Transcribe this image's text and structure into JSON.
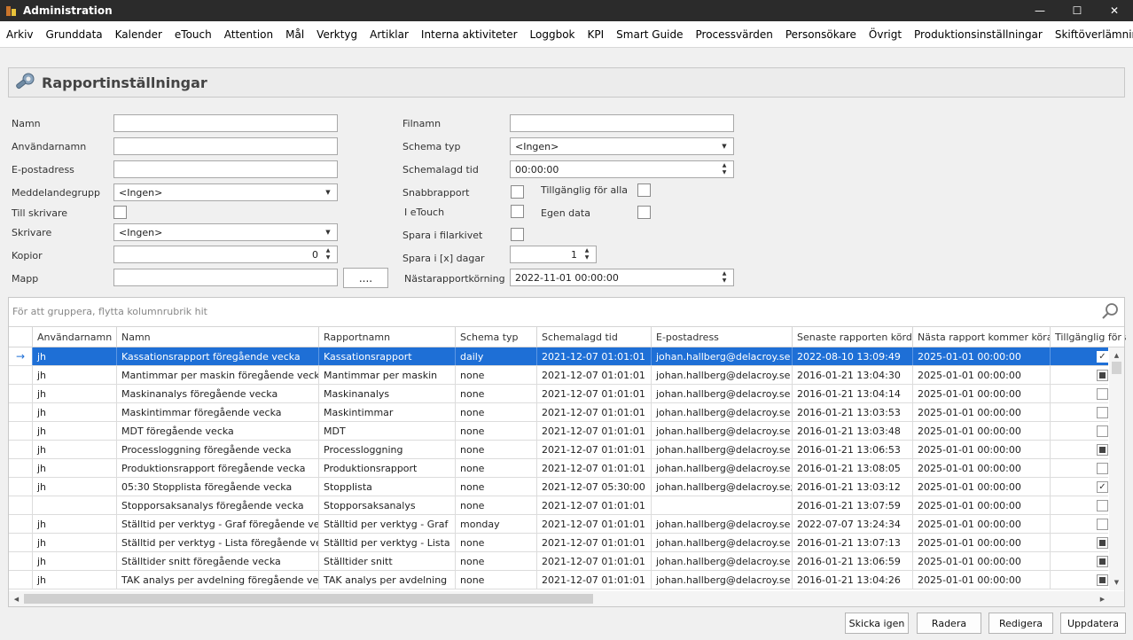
{
  "window": {
    "title": "Administration",
    "icon": "app-logo-icon",
    "controls": [
      "minimize-icon",
      "maximize-icon",
      "close-icon"
    ]
  },
  "menu": [
    "Arkiv",
    "Grunddata",
    "Kalender",
    "eTouch",
    "Attention",
    "Mål",
    "Verktyg",
    "Artiklar",
    "Interna aktiviteter",
    "Loggbok",
    "KPI",
    "Smart Guide",
    "Processvärden",
    "Personsökare",
    "Övrigt",
    "Produktionsinställningar",
    "Skiftöverlämning"
  ],
  "panel": {
    "title": "Rapportinställningar",
    "icon": "wrench-icon"
  },
  "form": {
    "left": {
      "namn": {
        "label": "Namn",
        "value": ""
      },
      "anvandarnamn": {
        "label": "Användarnamn",
        "value": ""
      },
      "epost": {
        "label": "E-postadress",
        "value": ""
      },
      "meddelandegrupp": {
        "label": "Meddelandegrupp",
        "value": "<Ingen>"
      },
      "till_skrivare": {
        "label": "Till skrivare",
        "checked": false
      },
      "skrivare": {
        "label": "Skrivare",
        "value": "<Ingen>"
      },
      "kopior": {
        "label": "Kopior",
        "value": "0"
      },
      "mapp": {
        "label": "Mapp",
        "value": "",
        "browse": "...."
      }
    },
    "right": {
      "filnamn": {
        "label": "Filnamn",
        "value": ""
      },
      "schema_typ": {
        "label": "Schema typ",
        "value": "<Ingen>"
      },
      "schemalagd_tid": {
        "label": "Schemalagd tid",
        "value": "00:00:00"
      },
      "snabbrapport": {
        "label": "Snabbrapport",
        "checked": false
      },
      "tillganglig": {
        "label": "Tillgänglig för alla",
        "checked": false
      },
      "i_etouch": {
        "label": "I eTouch",
        "checked": false
      },
      "egen_data": {
        "label": "Egen data",
        "checked": false
      },
      "spara_filarkivet": {
        "label": "Spara i filarkivet",
        "checked": false
      },
      "spara_dagar": {
        "label": "Spara i [x] dagar",
        "value": "1"
      },
      "nasta_korning": {
        "label": "Nästarapportkörning",
        "value": "2022-11-01 00:00:00"
      }
    }
  },
  "grid": {
    "group_hint": "För att gruppera, flytta kolumnrubrik hit",
    "columns": [
      "Användarnamn",
      "Namn",
      "Rapportnamn",
      "Schema typ",
      "Schemalagd tid",
      "E-postadress",
      "Senaste rapporten körd...",
      "Nästa rapport kommer köras",
      "Tillgänglig för alla"
    ],
    "rows": [
      {
        "user": "jh",
        "name": "Kassationsrapport föregående vecka",
        "report": "Kassationsrapport",
        "schema": "daily",
        "time": "2021-12-07 01:01:01",
        "email": "johan.hallberg@delacroy.se",
        "last": "2022-08-10 13:09:49",
        "next": "2025-01-01 00:00:00",
        "avail": "checked",
        "selected": true
      },
      {
        "user": "jh",
        "name": "Mantimmar per maskin föregående vecka",
        "report": "Mantimmar per maskin",
        "schema": "none",
        "time": "2021-12-07 01:01:01",
        "email": "johan.hallberg@delacroy.se",
        "last": "2016-01-21 13:04:30",
        "next": "2025-01-01 00:00:00",
        "avail": "indeterminate"
      },
      {
        "user": "jh",
        "name": "Maskinanalys föregående vecka",
        "report": "Maskinanalys",
        "schema": "none",
        "time": "2021-12-07 01:01:01",
        "email": "johan.hallberg@delacroy.se",
        "last": "2016-01-21 13:04:14",
        "next": "2025-01-01 00:00:00",
        "avail": "unchecked"
      },
      {
        "user": "jh",
        "name": "Maskintimmar föregående vecka",
        "report": "Maskintimmar",
        "schema": "none",
        "time": "2021-12-07 01:01:01",
        "email": "johan.hallberg@delacroy.se",
        "last": "2016-01-21 13:03:53",
        "next": "2025-01-01 00:00:00",
        "avail": "unchecked"
      },
      {
        "user": "jh",
        "name": "MDT föregående vecka",
        "report": "MDT",
        "schema": "none",
        "time": "2021-12-07 01:01:01",
        "email": "johan.hallberg@delacroy.se",
        "last": "2016-01-21 13:03:48",
        "next": "2025-01-01 00:00:00",
        "avail": "unchecked"
      },
      {
        "user": "jh",
        "name": "Processloggning föregående vecka",
        "report": "Processloggning",
        "schema": "none",
        "time": "2021-12-07 01:01:01",
        "email": "johan.hallberg@delacroy.se",
        "last": "2016-01-21 13:06:53",
        "next": "2025-01-01 00:00:00",
        "avail": "indeterminate"
      },
      {
        "user": "jh",
        "name": "Produktionsrapport föregående vecka",
        "report": "Produktionsrapport",
        "schema": "none",
        "time": "2021-12-07 01:01:01",
        "email": "johan.hallberg@delacroy.se",
        "last": "2016-01-21 13:08:05",
        "next": "2025-01-01 00:00:00",
        "avail": "unchecked"
      },
      {
        "user": "jh",
        "name": "05:30 Stopplista föregående vecka",
        "report": "Stopplista",
        "schema": "none",
        "time": "2021-12-07 05:30:00",
        "email": "johan.hallberg@delacroy.se;",
        "last": "2016-01-21 13:03:12",
        "next": "2025-01-01 00:00:00",
        "avail": "checked"
      },
      {
        "user": "",
        "name": "Stopporsaksanalys föregående vecka",
        "report": "Stopporsaksanalys",
        "schema": "none",
        "time": "2021-12-07 01:01:01",
        "email": "",
        "last": "2016-01-21 13:07:59",
        "next": "2025-01-01 00:00:00",
        "avail": "unchecked"
      },
      {
        "user": "jh",
        "name": "Ställtid per verktyg - Graf föregående vecka",
        "report": "Ställtid per verktyg - Graf",
        "schema": "monday",
        "time": "2021-12-07 01:01:01",
        "email": "johan.hallberg@delacroy.se",
        "last": "2022-07-07 13:24:34",
        "next": "2025-01-01 00:00:00",
        "avail": "unchecked"
      },
      {
        "user": "jh",
        "name": "Ställtid per verktyg - Lista föregående vecka",
        "report": "Ställtid per verktyg - Lista",
        "schema": "none",
        "time": "2021-12-07 01:01:01",
        "email": "johan.hallberg@delacroy.se",
        "last": "2016-01-21 13:07:13",
        "next": "2025-01-01 00:00:00",
        "avail": "indeterminate"
      },
      {
        "user": "jh",
        "name": "Ställtider snitt föregående vecka",
        "report": "Ställtider snitt",
        "schema": "none",
        "time": "2021-12-07 01:01:01",
        "email": "johan.hallberg@delacroy.se",
        "last": "2016-01-21 13:06:59",
        "next": "2025-01-01 00:00:00",
        "avail": "indeterminate"
      },
      {
        "user": "jh",
        "name": "TAK analys per avdelning föregående vecka",
        "report": "TAK analys per avdelning",
        "schema": "none",
        "time": "2021-12-07 01:01:01",
        "email": "johan.hallberg@delacroy.se",
        "last": "2016-01-21 13:04:26",
        "next": "2025-01-01 00:00:00",
        "avail": "indeterminate"
      }
    ]
  },
  "buttons": [
    "Skicka igen",
    "Radera",
    "Redigera",
    "Uppdatera"
  ]
}
